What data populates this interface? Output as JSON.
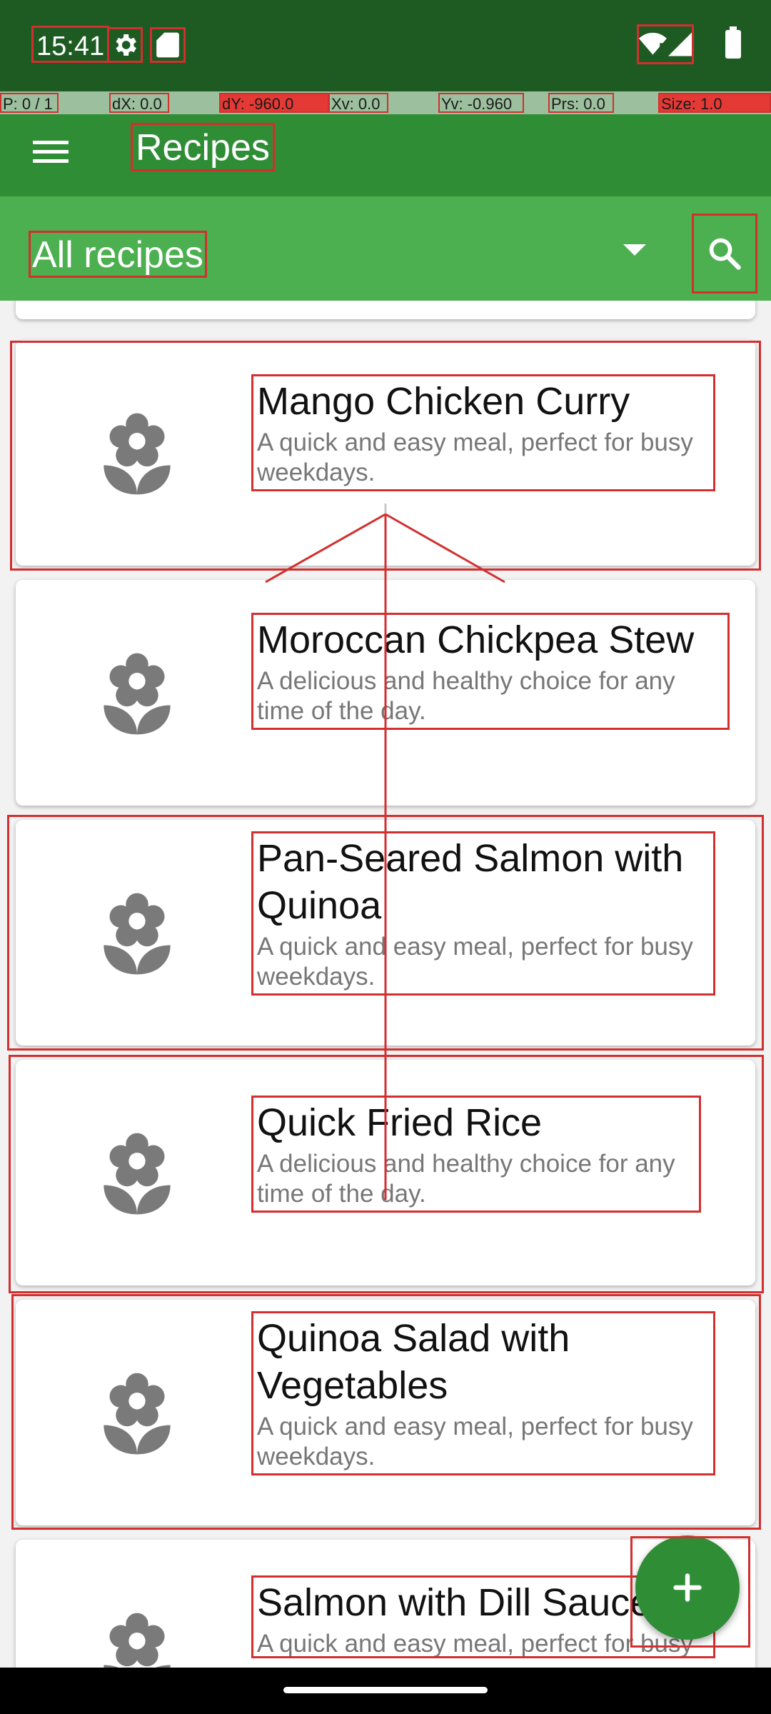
{
  "status_bar": {
    "time": "15:41",
    "icons": [
      "settings-icon",
      "sd-card-icon",
      "wifi-alert-icon",
      "signal-icon",
      "battery-icon"
    ]
  },
  "debug_overlay": {
    "pointer": "P: 0 / 1",
    "dx": "dX: 0.0",
    "dy": "dY: -960.0",
    "xv": "Xv: 0.0",
    "yv": "Yv: -0.960",
    "prs": "Prs: 0.0",
    "size": "Size: 1.0"
  },
  "app_bar": {
    "title": "Recipes",
    "menu_icon": "menu-icon"
  },
  "filter_bar": {
    "selected": "All recipes",
    "dropdown_icon": "chevron-down-icon",
    "search_icon": "search-icon"
  },
  "recipes": [
    {
      "title": "Mango Chicken Curry",
      "description": "A quick and easy meal, perfect for busy weekdays."
    },
    {
      "title": "Moroccan Chickpea Stew",
      "description": "A delicious and healthy choice for any time of the day."
    },
    {
      "title": "Pan-Seared Salmon with Quinoa",
      "description": "A quick and easy meal, perfect for busy weekdays."
    },
    {
      "title": "Quick Fried Rice",
      "description": "A delicious and healthy choice for any time of the day."
    },
    {
      "title": "Quinoa Salad with Vegetables",
      "description": "A quick and easy meal, perfect for busy weekdays."
    },
    {
      "title": "Salmon with Dill Sauce",
      "description": "A quick and easy meal, perfect for busy weekdays."
    }
  ],
  "fab": {
    "label": "+",
    "icon": "plus-icon"
  },
  "colors": {
    "status_bar": "#1e5b22",
    "app_bar": "#2f8d35",
    "filter_bar": "#4caf50",
    "fab": "#2f8d35",
    "icon_gray": "#7a7a7a",
    "debug_highlight": "#d32f2f"
  }
}
